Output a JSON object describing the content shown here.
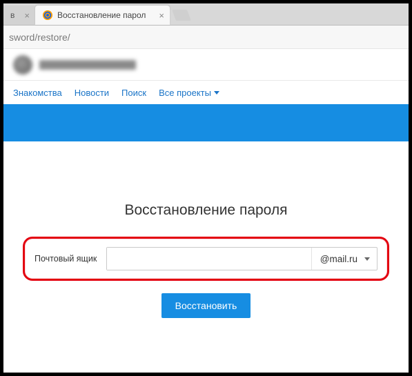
{
  "browser": {
    "tab_inactive_hint": "в",
    "tab_active_title": "Восстановление парол",
    "url_fragment": "sword/restore/"
  },
  "nav": {
    "items": [
      "Знакомства",
      "Новости",
      "Поиск"
    ],
    "projects_label": "Все проекты"
  },
  "page": {
    "heading": "Восстановление пароля",
    "field_label": "Почтовый ящик",
    "input_value": "",
    "domain_selected": "@mail.ru",
    "submit_label": "Восстановить"
  },
  "colors": {
    "accent": "#168de2",
    "highlight": "#e3000f",
    "link": "#1a74c7"
  }
}
